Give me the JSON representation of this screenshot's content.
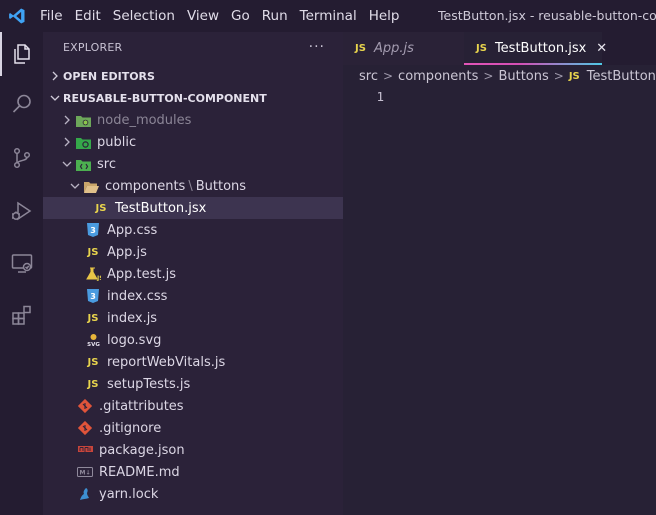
{
  "titlebar": {
    "menu": [
      "File",
      "Edit",
      "Selection",
      "View",
      "Go",
      "Run",
      "Terminal",
      "Help"
    ],
    "window_title": "TestButton.jsx - reusable-button-component - Visual Studio Code"
  },
  "activity_bar": {
    "items": [
      "explorer",
      "search",
      "source-control",
      "run-and-debug",
      "remote-explorer",
      "extensions"
    ],
    "active": "explorer"
  },
  "sidebar": {
    "title": "EXPLORER",
    "more": "···",
    "open_editors": "OPEN EDITORS",
    "project": "REUSABLE-BUTTON-COMPONENT",
    "tree": {
      "node_modules": "node_modules",
      "public": "public",
      "src": "src",
      "components": "components",
      "buttons": "Buttons",
      "path_sep": "\\",
      "test_button": "TestButton.jsx",
      "app_css": "App.css",
      "app_js": "App.js",
      "app_test": "App.test.js",
      "index_css": "index.css",
      "index_js": "index.js",
      "logo": "logo.svg",
      "report": "reportWebVitals.js",
      "setup": "setupTests.js",
      "gitattributes": ".gitattributes",
      "gitignore": ".gitignore",
      "package": "package.json",
      "readme": "README.md",
      "yarn": "yarn.lock"
    },
    "icon_labels": {
      "js": "JS",
      "css": "3",
      "svg": "SVG",
      "md": "M↓"
    }
  },
  "tabs": [
    {
      "label": "App.js",
      "active": false
    },
    {
      "label": "TestButton.jsx",
      "active": true,
      "close": "✕"
    }
  ],
  "breadcrumb": [
    "src",
    "components",
    "Buttons",
    "TestButton.jsx"
  ],
  "breadcrumb_sep": ">",
  "editor": {
    "line_numbers": [
      "1"
    ]
  },
  "colors": {
    "js": "#e8d44d",
    "css": "#4a9be0",
    "git": "#e0543a",
    "folder": "#d9b77a",
    "accent_gradient_start": "#e255b8",
    "accent_gradient_end": "#4ec9e6",
    "vscode_blue": "#3fa3f5"
  }
}
